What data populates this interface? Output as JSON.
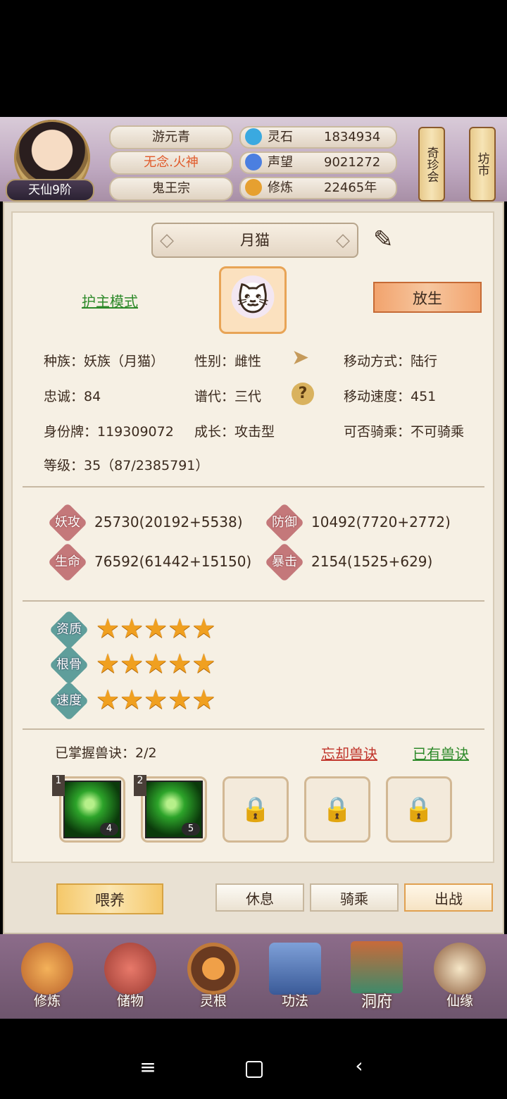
{
  "header": {
    "rank": "天仙9阶",
    "name": "游元青",
    "title": "无念.火神",
    "sect": "鬼王宗",
    "resources": [
      {
        "label": "灵石",
        "value": "1834934",
        "icon": "spirit-stone-icon",
        "color": "#3aa9e0"
      },
      {
        "label": "声望",
        "value": "9021272",
        "icon": "reputation-icon",
        "color": "#4b7fe0"
      },
      {
        "label": "修炼",
        "value": "22465年",
        "icon": "cultivation-icon",
        "color": "#e6a030"
      }
    ],
    "side_buttons": [
      "奇珍会",
      "坊市"
    ]
  },
  "pet": {
    "name": "月猫",
    "mode_link": "护主模式",
    "release_button": "放生",
    "info": {
      "race": "种族：妖族（月猫）",
      "gender": "性别：雌性",
      "move_type": "移动方式：陆行",
      "loyalty": "忠诚：84",
      "generation": "谱代：三代",
      "move_speed": "移动速度：451",
      "id_card": "身份牌：119309072",
      "growth": "成长：攻击型",
      "rideable": "可否骑乘：不可骑乘",
      "level": "等级：35（87/2385791）"
    },
    "stats": [
      {
        "label": "妖攻",
        "value": "25730(20192+5538)"
      },
      {
        "label": "防御",
        "value": "10492(7720+2772)"
      },
      {
        "label": "生命",
        "value": "76592(61442+15150)"
      },
      {
        "label": "暴击",
        "value": "2154(1525+629)"
      }
    ],
    "qualities": [
      {
        "label": "资质",
        "stars": 5
      },
      {
        "label": "根骨",
        "stars": 5
      },
      {
        "label": "速度",
        "stars": 5
      }
    ],
    "skills_header": "已掌握兽诀：2/2",
    "forget_link": "忘却兽诀",
    "owned_link": "已有兽诀",
    "skills": [
      {
        "slot": "1",
        "level": "4"
      },
      {
        "slot": "2",
        "level": "5"
      }
    ],
    "locked_slots": 3
  },
  "actions": {
    "feed": "喂养",
    "rest": "休息",
    "ride": "骑乘",
    "battle": "出战"
  },
  "bottom_nav": [
    {
      "label": "修炼",
      "icon": "cultivate-icon",
      "color": "#d98a3a"
    },
    {
      "label": "储物",
      "icon": "storage-bag-icon",
      "color": "#c0504a"
    },
    {
      "label": "灵根",
      "icon": "spirit-root-icon",
      "color": "#b0642c"
    },
    {
      "label": "功法",
      "icon": "technique-book-icon",
      "color": "#4a6aa8"
    },
    {
      "label": "洞府",
      "icon": "cave-house-icon",
      "color": "#3f8a6a"
    },
    {
      "label": "仙缘",
      "icon": "fate-gourd-icon",
      "color": "#8a5a3a"
    }
  ]
}
